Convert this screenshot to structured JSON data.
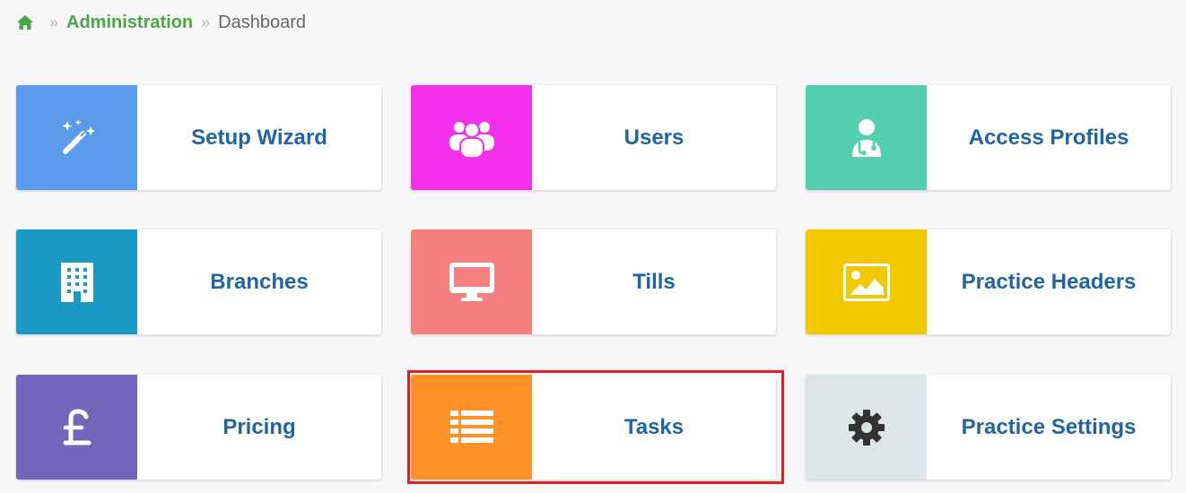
{
  "breadcrumb": {
    "home_icon": "home-icon",
    "separator": "»",
    "items": [
      {
        "label": "Administration",
        "link": true
      },
      {
        "label": "Dashboard",
        "link": false
      }
    ]
  },
  "tiles": [
    {
      "label": "Setup Wizard",
      "icon": "magic-wand-icon",
      "color": "#5b9bec"
    },
    {
      "label": "Users",
      "icon": "users-group-icon",
      "color": "#f530ea"
    },
    {
      "label": "Access Profiles",
      "icon": "doctor-icon",
      "color": "#55cfb0"
    },
    {
      "label": "Branches",
      "icon": "building-icon",
      "color": "#1a99c4"
    },
    {
      "label": "Tills",
      "icon": "monitor-icon",
      "color": "#f58080"
    },
    {
      "label": "Practice Headers",
      "icon": "image-icon",
      "color": "#f2c900"
    },
    {
      "label": "Pricing",
      "icon": "pound-icon",
      "color": "#7266bb"
    },
    {
      "label": "Tasks",
      "icon": "list-icon",
      "color": "#ff932a",
      "highlighted": true
    },
    {
      "label": "Practice Settings",
      "icon": "gear-icon",
      "color": "#dde5e8"
    }
  ],
  "colors": {
    "label": "#1f65a5",
    "breadcrumb_link": "#4aa843",
    "highlight_border": "#e02020"
  }
}
